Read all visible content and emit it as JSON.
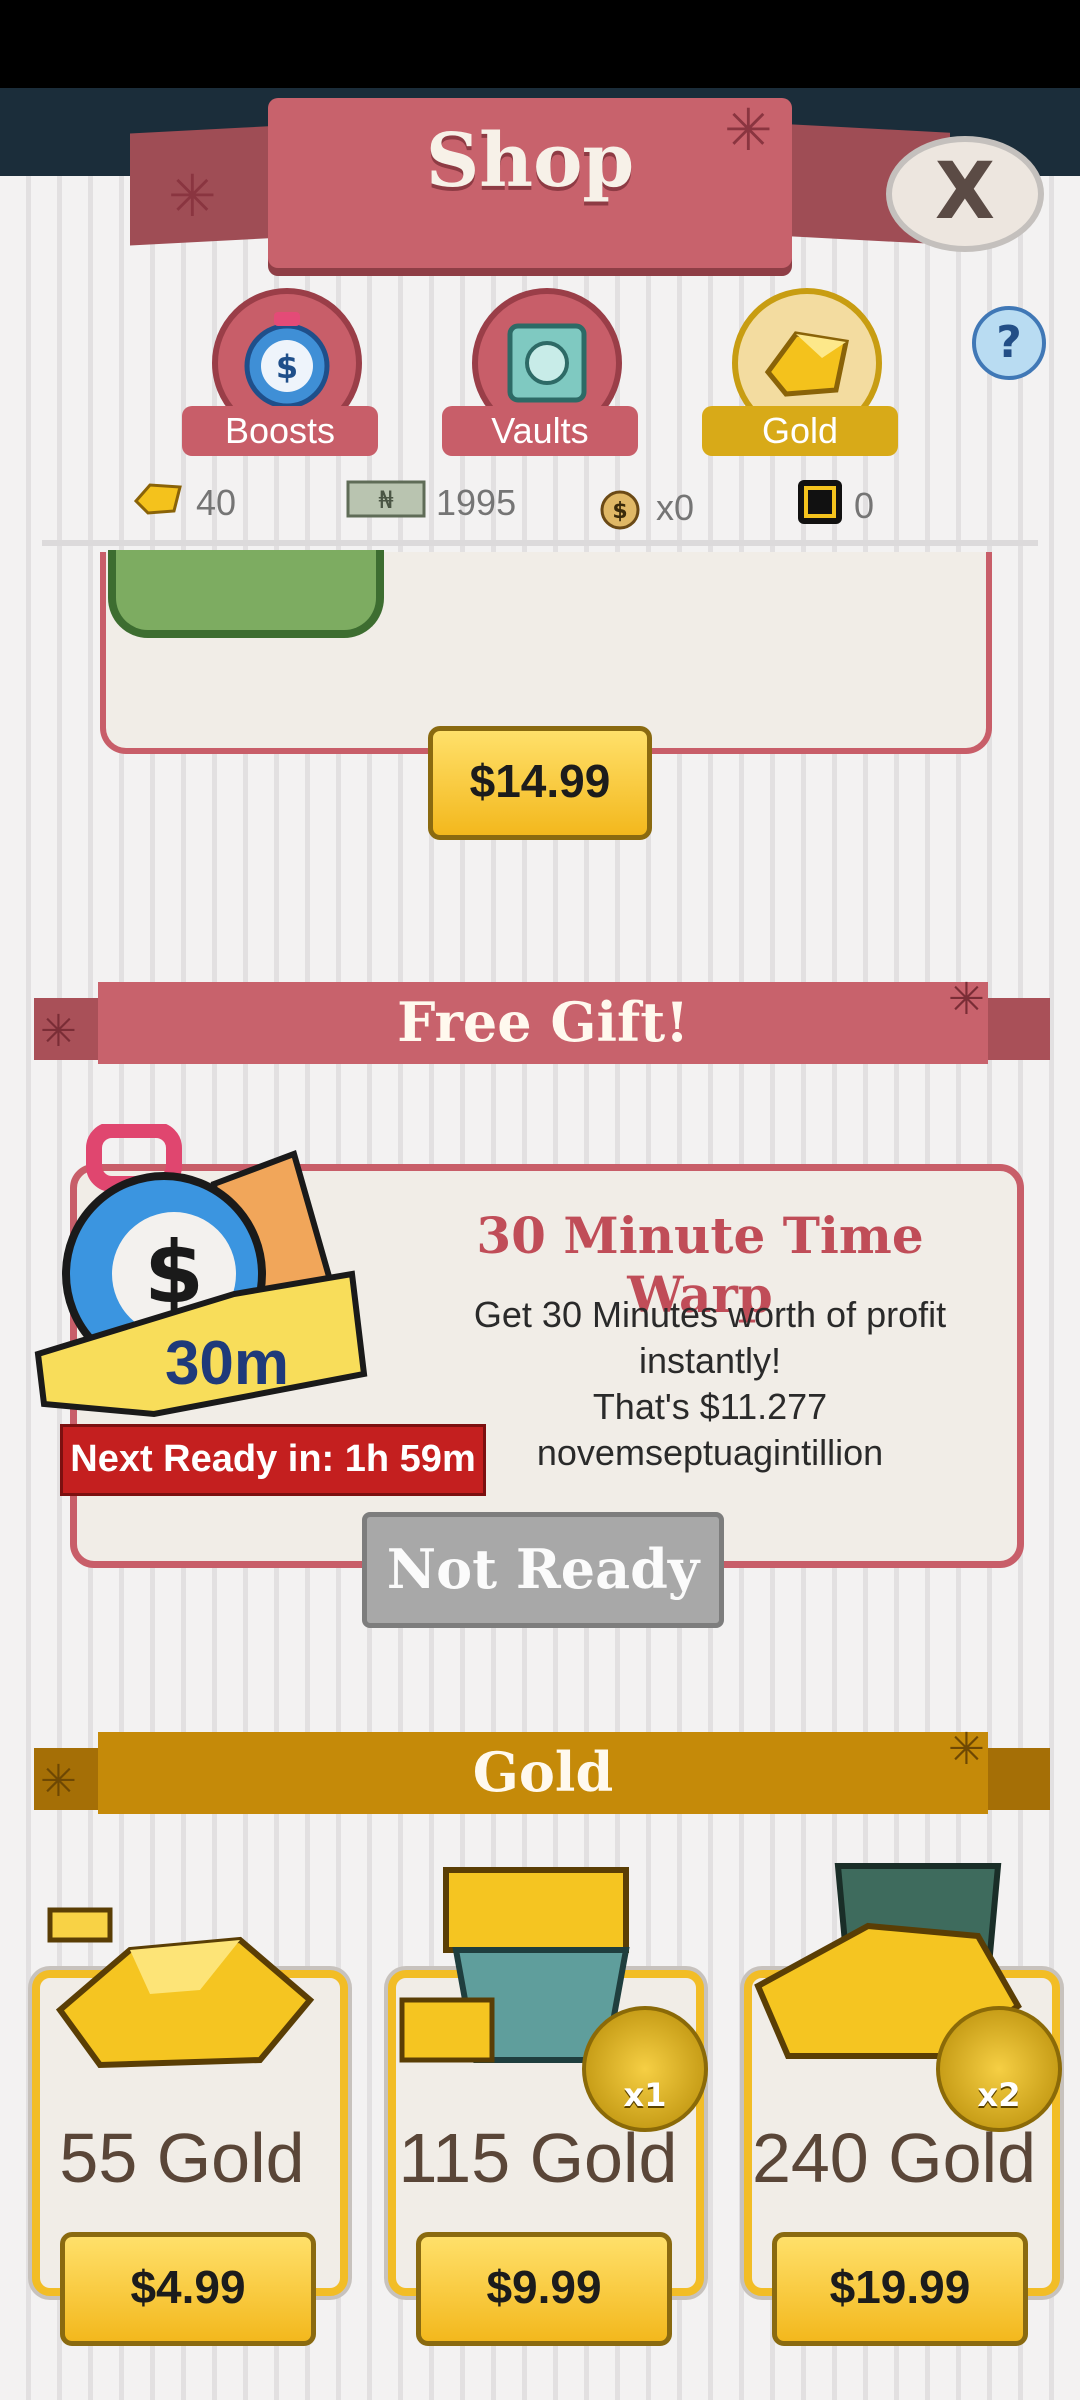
{
  "header": {
    "title": "Shop",
    "close_label": "X"
  },
  "tabs": [
    {
      "label": "Boosts",
      "icon": "stopwatch-icon",
      "color": "#c85e69",
      "active": false
    },
    {
      "label": "Vaults",
      "icon": "vault-icon",
      "color": "#c85e69",
      "active": false
    },
    {
      "label": "Gold",
      "icon": "gold-icon",
      "color": "#d8aa18",
      "active": true
    }
  ],
  "help_label": "?",
  "currencies": [
    {
      "icon": "gold-icon",
      "value": "40"
    },
    {
      "icon": "cash-icon",
      "value": "1995"
    },
    {
      "icon": "money-bag-icon",
      "value": "x0"
    },
    {
      "icon": "badge-icon",
      "value": "0"
    }
  ],
  "top_offer": {
    "price": "$14.99"
  },
  "free_gift": {
    "section_title": "Free Gift!",
    "title": "30 Minute Time Warp",
    "description": "Get 30 Minutes worth of profit instantly!",
    "value_text": "That's $11.277 novemseptuagintillion",
    "duration_badge": "30m",
    "next_ready": "Next Ready in: 1h 59m",
    "button": "Not Ready"
  },
  "gold_section": {
    "title": "Gold",
    "packs": [
      {
        "label": "55 Gold",
        "price": "$4.99",
        "multiplier": ""
      },
      {
        "label": "115 Gold",
        "price": "$9.99",
        "multiplier": "x1"
      },
      {
        "label": "240 Gold",
        "price": "$19.99",
        "multiplier": "x2"
      }
    ]
  },
  "colors": {
    "accent_red": "#c85e69",
    "gold": "#f2bd26",
    "section_gold": "#c58a09"
  }
}
